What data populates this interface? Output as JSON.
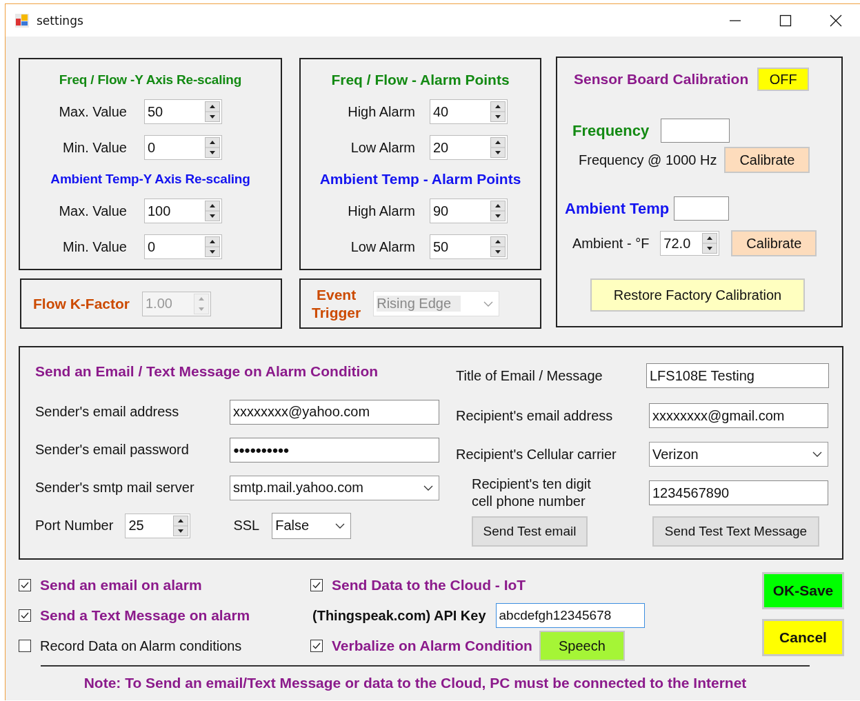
{
  "window": {
    "title": "settings"
  },
  "scaling_panel": {
    "sections": [
      {
        "title": "Freq / Flow -Y Axis Re-scaling",
        "color": "#138a13",
        "fields": [
          {
            "label": "Max. Value",
            "value": "50"
          },
          {
            "label": "Min. Value",
            "value": "0"
          }
        ]
      },
      {
        "title": "Ambient Temp-Y Axis Re-scaling",
        "color": "#1414f0",
        "fields": [
          {
            "label": "Max. Value",
            "value": "100"
          },
          {
            "label": "Min. Value",
            "value": "0"
          }
        ]
      }
    ]
  },
  "alarm_panel": {
    "sections": [
      {
        "title": "Freq / Flow - Alarm Points",
        "color": "#138a13",
        "fields": [
          {
            "label": "High Alarm",
            "value": "40"
          },
          {
            "label": "Low Alarm",
            "value": "20"
          }
        ]
      },
      {
        "title": "Ambient Temp - Alarm Points",
        "color": "#1414f0",
        "fields": [
          {
            "label": "High Alarm",
            "value": "90"
          },
          {
            "label": "Low Alarm",
            "value": "50"
          }
        ]
      }
    ]
  },
  "k_factor": {
    "label": "Flow K-Factor",
    "value": "1.00",
    "disabled": true
  },
  "event_trigger": {
    "label": "Event\nTrigger",
    "value": "Rising Edge",
    "disabled": true
  },
  "calibration": {
    "title": "Sensor Board Calibration",
    "toggle": "OFF",
    "frequency": {
      "heading": "Frequency",
      "label": "Frequency @ 1000 Hz",
      "button": "Calibrate"
    },
    "ambient": {
      "heading": "Ambient Temp",
      "label": "Ambient - °F",
      "value": "72.0",
      "button": "Calibrate"
    },
    "restore_button": "Restore Factory Calibration"
  },
  "email": {
    "title": "Send an Email / Text Message on Alarm Condition",
    "sender_fields": [
      {
        "kind": "text",
        "label": "Sender's email address",
        "value": "xxxxxxxx@yahoo.com"
      },
      {
        "kind": "password",
        "label": "Sender's email password",
        "value": "●●●●●●●●●●"
      },
      {
        "kind": "dropdown",
        "label": "Sender's smtp mail server",
        "value": "smtp.mail.yahoo.com"
      }
    ],
    "port": {
      "label": "Port Number",
      "value": "25"
    },
    "ssl": {
      "label": "SSL",
      "value": "False"
    },
    "recipient_fields": [
      {
        "kind": "text",
        "label": "Title of Email / Message",
        "value": "LFS108E Testing"
      },
      {
        "kind": "text",
        "label": "Recipient's email address",
        "value": "xxxxxxxx@gmail.com"
      },
      {
        "kind": "dropdown",
        "label": "Recipient's Cellular carrier",
        "value": "Verizon"
      },
      {
        "kind": "wrapped",
        "label": "Recipient's ten digit\ncell phone number",
        "value": "1234567890"
      }
    ],
    "buttons": [
      "Send Test email",
      "Send Test Text Message"
    ]
  },
  "options": [
    {
      "label": "Send an email on alarm",
      "checked": true
    },
    {
      "label": "Send a Text Message on alarm",
      "checked": true
    },
    {
      "label": "Record Data on Alarm conditions",
      "checked": false
    }
  ],
  "cloud": {
    "label": "Send Data to the Cloud - IoT",
    "checked": true,
    "api_key_label": "(Thingspeak.com) API Key",
    "api_key": "abcdefgh12345678"
  },
  "verbalize": {
    "label": "Verbalize on Alarm Condition",
    "checked": true,
    "button": "Speech"
  },
  "actions": [
    {
      "label": "OK-Save",
      "color": "#00ff00"
    },
    {
      "label": "Cancel",
      "color": "#ffff00"
    }
  ],
  "note": "Note: To Send an email/Text Message or data to the Cloud, PC must be connected to the Internet"
}
